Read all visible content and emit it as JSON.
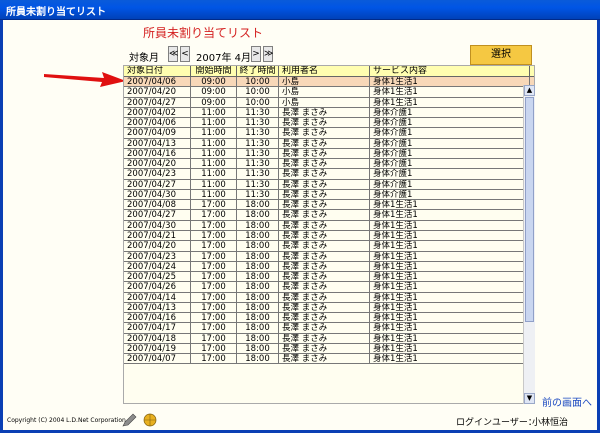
{
  "window": {
    "title": "所員未割り当てリスト"
  },
  "page": {
    "title": "所員未割り当てリスト"
  },
  "period": {
    "label": "対象月",
    "first_btn": "≪",
    "prev_btn": "<",
    "value": "2007年 4月",
    "next_btn": ">",
    "last_btn": "≫"
  },
  "select_button": "選択",
  "columns": [
    "対象日付",
    "開始時間",
    "終了時間",
    "利用者名",
    "サービス内容"
  ],
  "rows": [
    [
      "2007/04/06",
      "09:00",
      "10:00",
      "小島",
      "身体1生活1"
    ],
    [
      "2007/04/20",
      "09:00",
      "10:00",
      "小島",
      "身体1生活1"
    ],
    [
      "2007/04/27",
      "09:00",
      "10:00",
      "小島",
      "身体1生活1"
    ],
    [
      "2007/04/02",
      "11:00",
      "11:30",
      "長澤 まさみ",
      "身体介護1"
    ],
    [
      "2007/04/06",
      "11:00",
      "11:30",
      "長澤 まさみ",
      "身体介護1"
    ],
    [
      "2007/04/09",
      "11:00",
      "11:30",
      "長澤 まさみ",
      "身体介護1"
    ],
    [
      "2007/04/13",
      "11:00",
      "11:30",
      "長澤 まさみ",
      "身体介護1"
    ],
    [
      "2007/04/16",
      "11:00",
      "11:30",
      "長澤 まさみ",
      "身体介護1"
    ],
    [
      "2007/04/20",
      "11:00",
      "11:30",
      "長澤 まさみ",
      "身体介護1"
    ],
    [
      "2007/04/23",
      "11:00",
      "11:30",
      "長澤 まさみ",
      "身体介護1"
    ],
    [
      "2007/04/27",
      "11:00",
      "11:30",
      "長澤 まさみ",
      "身体介護1"
    ],
    [
      "2007/04/30",
      "11:00",
      "11:30",
      "長澤 まさみ",
      "身体介護1"
    ],
    [
      "2007/04/08",
      "17:00",
      "18:00",
      "長澤 まさみ",
      "身体1生活1"
    ],
    [
      "2007/04/27",
      "17:00",
      "18:00",
      "長澤 まさみ",
      "身体1生活1"
    ],
    [
      "2007/04/30",
      "17:00",
      "18:00",
      "長澤 まさみ",
      "身体1生活1"
    ],
    [
      "2007/04/21",
      "17:00",
      "18:00",
      "長澤 まさみ",
      "身体1生活1"
    ],
    [
      "2007/04/20",
      "17:00",
      "18:00",
      "長澤 まさみ",
      "身体1生活1"
    ],
    [
      "2007/04/23",
      "17:00",
      "18:00",
      "長澤 まさみ",
      "身体1生活1"
    ],
    [
      "2007/04/24",
      "17:00",
      "18:00",
      "長澤 まさみ",
      "身体1生活1"
    ],
    [
      "2007/04/25",
      "17:00",
      "18:00",
      "長澤 まさみ",
      "身体1生活1"
    ],
    [
      "2007/04/26",
      "17:00",
      "18:00",
      "長澤 まさみ",
      "身体1生活1"
    ],
    [
      "2007/04/14",
      "17:00",
      "18:00",
      "長澤 まさみ",
      "身体1生活1"
    ],
    [
      "2007/04/13",
      "17:00",
      "18:00",
      "長澤 まさみ",
      "身体1生活1"
    ],
    [
      "2007/04/16",
      "17:00",
      "18:00",
      "長澤 まさみ",
      "身体1生活1"
    ],
    [
      "2007/04/17",
      "17:00",
      "18:00",
      "長澤 まさみ",
      "身体1生活1"
    ],
    [
      "2007/04/18",
      "17:00",
      "18:00",
      "長澤 まさみ",
      "身体1生活1"
    ],
    [
      "2007/04/19",
      "17:00",
      "18:00",
      "長澤 まさみ",
      "身体1生活1"
    ],
    [
      "2007/04/07",
      "17:00",
      "18:00",
      "長澤 まさみ",
      "身体1生活1"
    ]
  ],
  "selected_row": 0,
  "prev_link": "前の画面へ",
  "footer": {
    "copyright": "Copyright (C) 2004 L.D.Net Corporation",
    "login_label": "ログインユーザー：",
    "login_user": "小林恒治"
  },
  "colors": {
    "title_red": "#d42020",
    "select_btn": "#f5c842",
    "header_row": "#fffeb0",
    "selected_row": "#f8d8b8",
    "arrow": "#e01010",
    "link_blue": "#1a48c0"
  },
  "icons": [
    "red-arrow-pointer-icon",
    "first-page-icon",
    "prev-page-icon",
    "next-page-icon",
    "last-page-icon",
    "scroll-up-icon",
    "scroll-down-icon",
    "pen-icon",
    "globe-icon"
  ]
}
